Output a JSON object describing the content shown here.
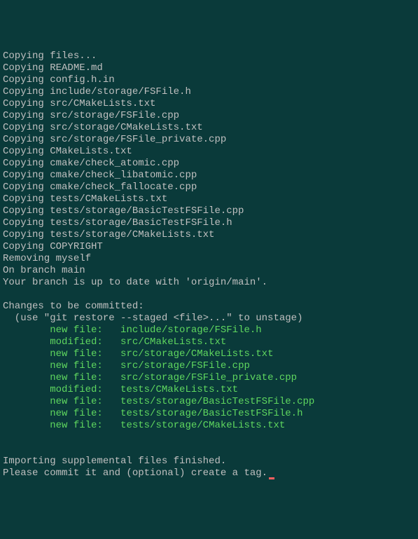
{
  "lines": [
    {
      "type": "plain",
      "text": "Copying files..."
    },
    {
      "type": "plain",
      "text": "Copying README.md"
    },
    {
      "type": "plain",
      "text": "Copying config.h.in"
    },
    {
      "type": "plain",
      "text": "Copying include/storage/FSFile.h"
    },
    {
      "type": "plain",
      "text": "Copying src/CMakeLists.txt"
    },
    {
      "type": "plain",
      "text": "Copying src/storage/FSFile.cpp"
    },
    {
      "type": "plain",
      "text": "Copying src/storage/CMakeLists.txt"
    },
    {
      "type": "plain",
      "text": "Copying src/storage/FSFile_private.cpp"
    },
    {
      "type": "plain",
      "text": "Copying CMakeLists.txt"
    },
    {
      "type": "plain",
      "text": "Copying cmake/check_atomic.cpp"
    },
    {
      "type": "plain",
      "text": "Copying cmake/check_libatomic.cpp"
    },
    {
      "type": "plain",
      "text": "Copying cmake/check_fallocate.cpp"
    },
    {
      "type": "plain",
      "text": "Copying tests/CMakeLists.txt"
    },
    {
      "type": "plain",
      "text": "Copying tests/storage/BasicTestFSFile.cpp"
    },
    {
      "type": "plain",
      "text": "Copying tests/storage/BasicTestFSFile.h"
    },
    {
      "type": "plain",
      "text": "Copying tests/storage/CMakeLists.txt"
    },
    {
      "type": "plain",
      "text": "Copying COPYRIGHT"
    },
    {
      "type": "plain",
      "text": "Removing myself"
    },
    {
      "type": "plain",
      "text": "On branch main"
    },
    {
      "type": "plain",
      "text": "Your branch is up to date with 'origin/main'."
    },
    {
      "type": "plain",
      "text": ""
    },
    {
      "type": "plain",
      "text": "Changes to be committed:"
    },
    {
      "type": "plain",
      "text": "  (use \"git restore --staged <file>...\" to unstage)"
    },
    {
      "type": "staged",
      "status": "new file:   ",
      "path": "include/storage/FSFile.h"
    },
    {
      "type": "staged",
      "status": "modified:   ",
      "path": "src/CMakeLists.txt"
    },
    {
      "type": "staged",
      "status": "new file:   ",
      "path": "src/storage/CMakeLists.txt"
    },
    {
      "type": "staged",
      "status": "new file:   ",
      "path": "src/storage/FSFile.cpp"
    },
    {
      "type": "staged",
      "status": "new file:   ",
      "path": "src/storage/FSFile_private.cpp"
    },
    {
      "type": "staged",
      "status": "modified:   ",
      "path": "tests/CMakeLists.txt"
    },
    {
      "type": "staged",
      "status": "new file:   ",
      "path": "tests/storage/BasicTestFSFile.cpp"
    },
    {
      "type": "staged",
      "status": "new file:   ",
      "path": "tests/storage/BasicTestFSFile.h"
    },
    {
      "type": "staged",
      "status": "new file:   ",
      "path": "tests/storage/CMakeLists.txt"
    },
    {
      "type": "plain",
      "text": ""
    },
    {
      "type": "plain",
      "text": ""
    },
    {
      "type": "plain",
      "text": "Importing supplemental files finished."
    },
    {
      "type": "cursor",
      "text": "Please commit it and (optional) create a tag."
    }
  ],
  "indent": "        "
}
